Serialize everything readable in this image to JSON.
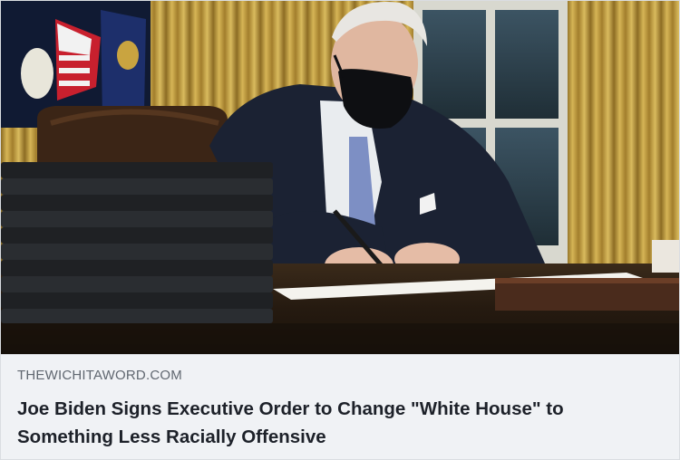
{
  "link_preview": {
    "domain": "THEWICHITAWORD.COM",
    "headline": "Joe Biden Signs Executive Order to Change \"White House\" to Something Less Racially Offensive"
  },
  "image": {
    "subject": "man-in-mask-signing-document-icon"
  },
  "colors": {
    "caption_bg": "#f0f2f5",
    "domain_text": "#606770",
    "headline_text": "#1d2129",
    "curtain_gold": "#b8963c",
    "suit_navy": "#1b2233",
    "tie_blue": "#7d8fc4"
  }
}
